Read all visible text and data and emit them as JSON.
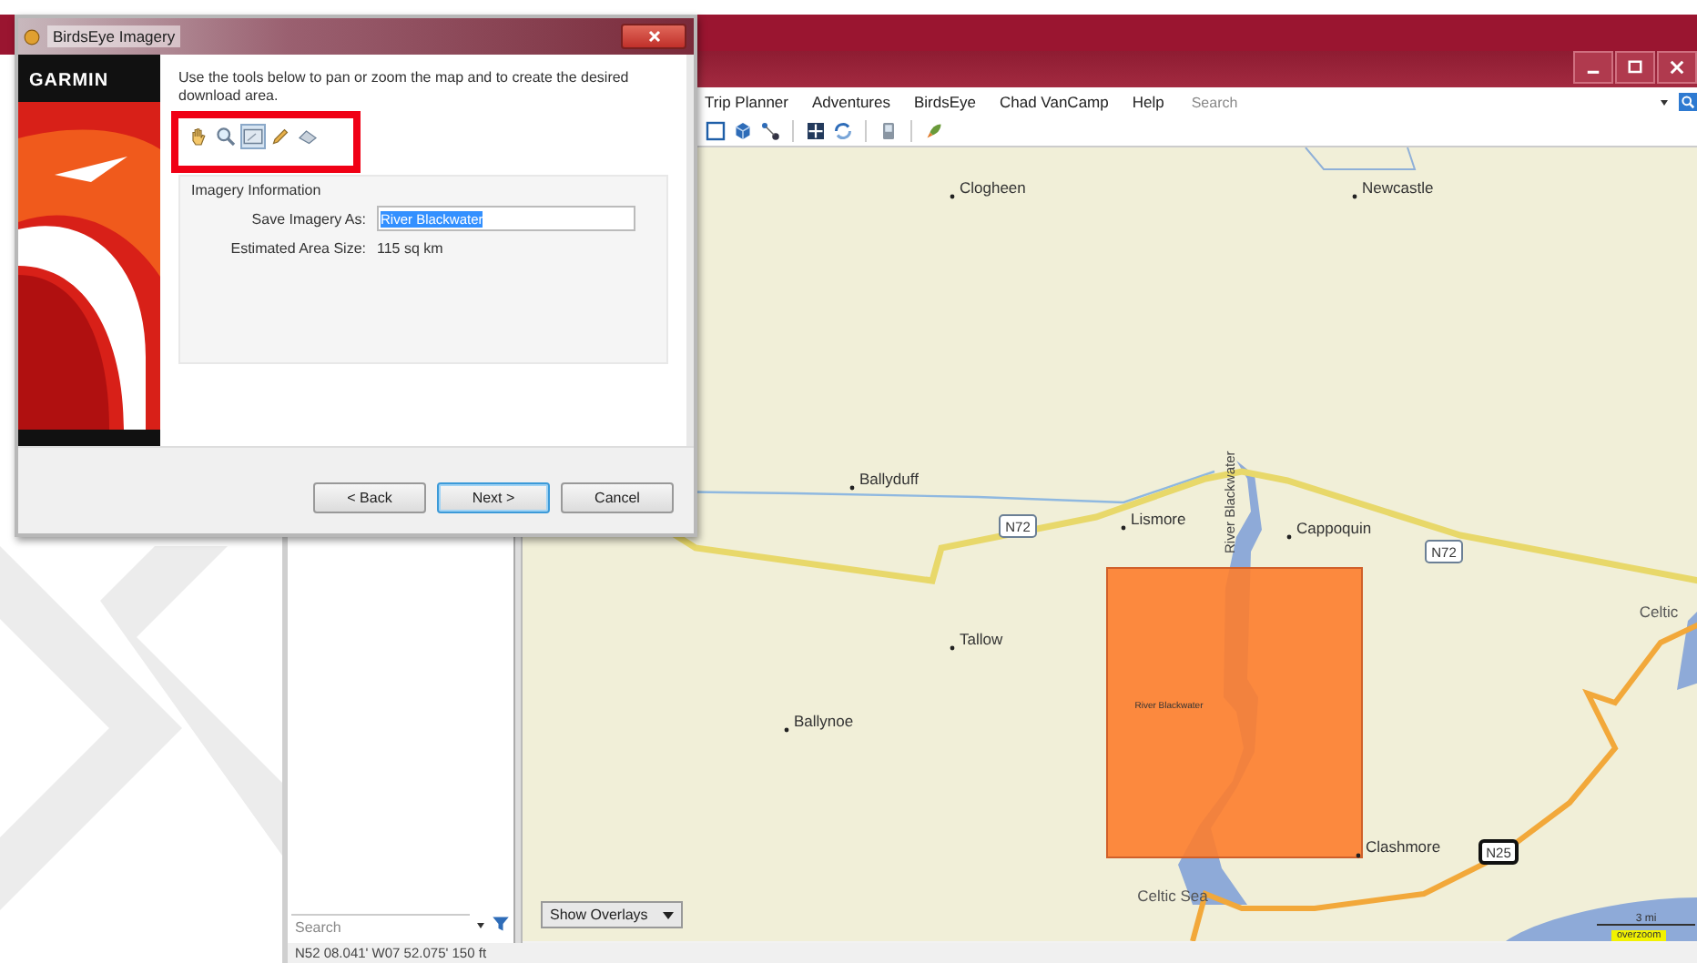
{
  "dialog": {
    "title": "BirdsEye Imagery",
    "brand": "GARMIN",
    "instructions": "Use the tools below to pan or zoom the map and to create the desired download area.",
    "tools": [
      {
        "kind": "pan",
        "selected": false
      },
      {
        "kind": "zoom",
        "selected": false
      },
      {
        "kind": "rectangle",
        "selected": true
      },
      {
        "kind": "draw",
        "selected": false
      },
      {
        "kind": "erase",
        "selected": false
      }
    ],
    "group_title": "Imagery Information",
    "fields": [
      {
        "kind": "input",
        "label": "Save Imagery As:",
        "value": "River Blackwater",
        "selected": true
      },
      {
        "kind": "text",
        "label": "Estimated Area Size:",
        "value": "115 sq km"
      }
    ],
    "buttons": [
      {
        "label": "< Back",
        "default": false
      },
      {
        "label": "Next >",
        "default": true
      },
      {
        "label": "Cancel",
        "default": false
      }
    ]
  },
  "app": {
    "menu": [
      "Trip Planner",
      "Adventures",
      "BirdsEye",
      "Chad VanCamp",
      "Help"
    ],
    "search": {
      "placeholder": "Search"
    },
    "toolbar": [
      {
        "kind": "select"
      },
      {
        "kind": "cube"
      },
      {
        "kind": "route"
      },
      {
        "kind": "fit"
      },
      {
        "kind": "sync"
      },
      {
        "kind": "device"
      },
      {
        "kind": "launch"
      }
    ],
    "sidebar": {
      "search": {
        "placeholder": "Search"
      }
    },
    "map": {
      "places": [
        {
          "kind": "town",
          "text": "Clogheen"
        },
        {
          "kind": "town",
          "text": "Newcastle"
        },
        {
          "kind": "town",
          "text": "Ballyduff"
        },
        {
          "kind": "town",
          "text": "Lismore"
        },
        {
          "kind": "town",
          "text": "Cappoquin"
        },
        {
          "kind": "town",
          "text": "Tallow"
        },
        {
          "kind": "town",
          "text": "Ballynoe"
        },
        {
          "kind": "town",
          "text": "Clashmore"
        },
        {
          "kind": "sea",
          "text": "Celtic Sea"
        },
        {
          "kind": "sea",
          "text": "Celtic"
        },
        {
          "kind": "road",
          "text": "N72"
        },
        {
          "kind": "road",
          "text": "N72"
        },
        {
          "kind": "major-road",
          "text": "N25"
        },
        {
          "kind": "river",
          "text": "River Blackwater"
        }
      ],
      "selection": {
        "label": "River Blackwater"
      },
      "overlays_button": "Show Overlays",
      "scale": "3 mi",
      "zoom_badge": "overzoom"
    },
    "status_bar": "N52 08.041' W07 52.075' 150 ft"
  }
}
